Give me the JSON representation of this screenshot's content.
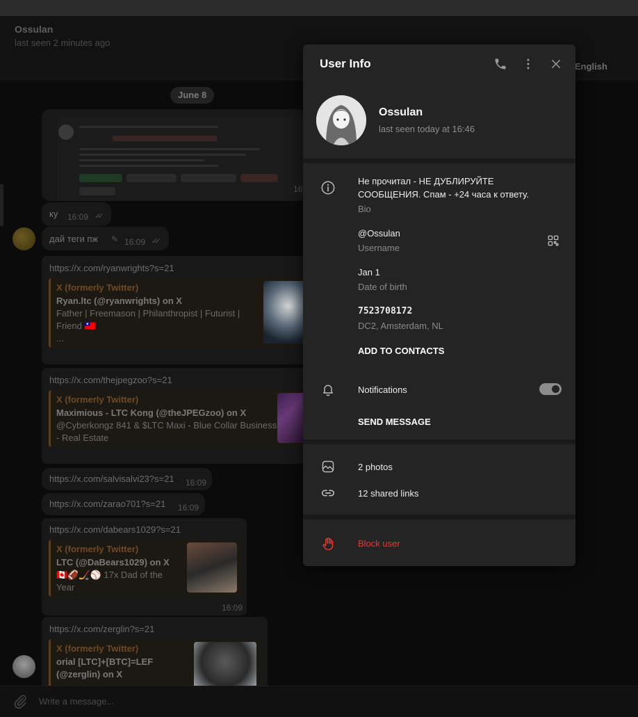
{
  "chat": {
    "name": "Ossulan",
    "status": "last seen 2 minutes ago",
    "lang_button": "English",
    "date_pill": "June 8",
    "composer_placeholder": "Write a message...",
    "messages": [
      {
        "text": "ку",
        "time": "16:09"
      },
      {
        "text": "дай теги пж",
        "time": "16:09"
      },
      {
        "url": "https://x.com/ryanwrights?s=21",
        "site": "X (formerly Twitter)",
        "title": "Ryan.ltc (@ryanwrights) on X",
        "desc_line1": "Father | Freemason | Philanthropist | Futurist |",
        "desc_line2": "Friend 🇹🇼",
        "desc_line3": "..."
      },
      {
        "url": "https://x.com/thejpegzoo?s=21",
        "site": "X (formerly Twitter)",
        "title": "Maximious - LTC Kong (@theJPEGzoo) on X",
        "desc_line1": "@Cyberkongz 841 & $LTC Maxi - Blue Collar Business",
        "desc_line2": "- Real Estate"
      },
      {
        "url": "https://x.com/salvisalvi23?s=21",
        "time": "16:09"
      },
      {
        "url": "https://x.com/zarao701?s=21",
        "time": "16:09"
      },
      {
        "url": "https://x.com/dabears1029?s=21",
        "site": "X (formerly Twitter)",
        "title": "LTC (@DaBears1029) on X",
        "desc_line1": "🇨🇦🏈🏒⚾ 17x Dad of the",
        "desc_line2": "Year",
        "time": "16:09"
      },
      {
        "url": "https://x.com/zerglin?s=21",
        "site": "X (formerly Twitter)",
        "title_line1": "orial [LTC]+[BTC]=LEF",
        "title_line2": "(@zerglin) on X"
      }
    ],
    "partial_time": "16"
  },
  "user_info": {
    "title": "User Info",
    "name": "Ossulan",
    "status": "last seen today at 16:46",
    "bio_line1": "Не прочитал - НЕ ДУБЛИРУЙТЕ",
    "bio_line2": "СООБЩЕНИЯ. Спам - +24 часа к ответу.",
    "bio_label": "Bio",
    "username": "@Ossulan",
    "username_label": "Username",
    "birth": "Jan 1",
    "birth_label": "Date of birth",
    "phone": "7523708172",
    "dc": "DC2, Amsterdam, NL",
    "add_contacts": "ADD TO CONTACTS",
    "notifications_label": "Notifications",
    "notifications_on": true,
    "send_message": "SEND MESSAGE",
    "photos": "2 photos",
    "links": "12 shared links",
    "block": "Block user"
  },
  "colors": {
    "panel_bg": "#242424",
    "accent_link": "#6e4a26",
    "danger": "#e53935"
  },
  "icons": [
    "phone-icon",
    "more-vert-icon",
    "close-icon",
    "info-icon",
    "qr-code-icon",
    "bell-icon",
    "photo-icon",
    "link-icon",
    "hand-stop-icon",
    "paperclip-icon",
    "double-check-icon",
    "pencil-icon"
  ]
}
